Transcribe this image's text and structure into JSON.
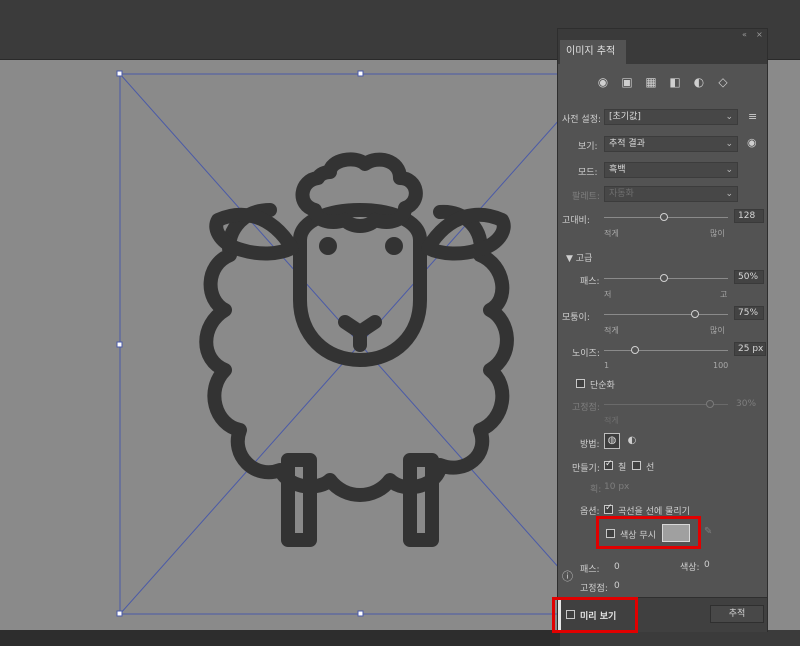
{
  "panel": {
    "title_tab": "이미지 추적",
    "grip_collapse_icon": "collapse-arrows-icon",
    "grip_close_icon": "close-icon",
    "preset_icons": [
      "auto-color-icon",
      "high-color-icon",
      "low-color-icon",
      "grayscale-icon",
      "black-white-icon",
      "outline-icon"
    ],
    "preset": {
      "label": "사전 설정:",
      "value": "[초기값]"
    },
    "view": {
      "label": "보기:",
      "value": "추적 결과"
    },
    "mode": {
      "label": "모드:",
      "value": "흑백"
    },
    "palette": {
      "label": "팔레트:",
      "value": "자동화"
    },
    "threshold": {
      "label": "고대비:",
      "value": "128",
      "min_label": "적게",
      "max_label": "많이",
      "fraction": 0.5
    },
    "advanced": {
      "label": "고급"
    },
    "paths": {
      "label": "패스:",
      "value": "50%",
      "min_label": "저",
      "max_label": "고",
      "fraction": 0.5
    },
    "corners": {
      "label": "모퉁이:",
      "value": "75%",
      "min_label": "적게",
      "max_label": "많이",
      "fraction": 0.75
    },
    "noise": {
      "label": "노이즈:",
      "value": "25 px",
      "min_label": "1",
      "max_label": "100",
      "fraction": 0.24
    },
    "simplify": {
      "label": "단순화",
      "checked": false
    },
    "snap": {
      "label": "고정점:",
      "value": "30%",
      "min_label": "적게",
      "fraction": 0.95
    },
    "method": {
      "label": "방법:"
    },
    "create": {
      "label": "만들기:",
      "fills_label": "칠",
      "fills_checked": true,
      "strokes_label": "선",
      "strokes_checked": false
    },
    "stroke": {
      "label": "획:",
      "value": "10 px"
    },
    "options": {
      "label": "옵션:",
      "curves_label": "곡선을 선에 물리기",
      "curves_checked": true
    },
    "ignore_color": {
      "label": "색상 무시",
      "checked": false,
      "swatch_color": "#a0a0a0"
    },
    "info": {
      "paths_label": "패스:",
      "paths_value": "0",
      "colors_label": "색상:",
      "colors_value": "0",
      "anchors_label": "고정점:",
      "anchors_value": "0"
    },
    "preview": {
      "label": "미리 보기",
      "checked": false
    },
    "trace_button": "추적"
  },
  "colors": {
    "highlight": "#e10000",
    "artwork": "#333333",
    "bbox": "#4a5aa8"
  }
}
